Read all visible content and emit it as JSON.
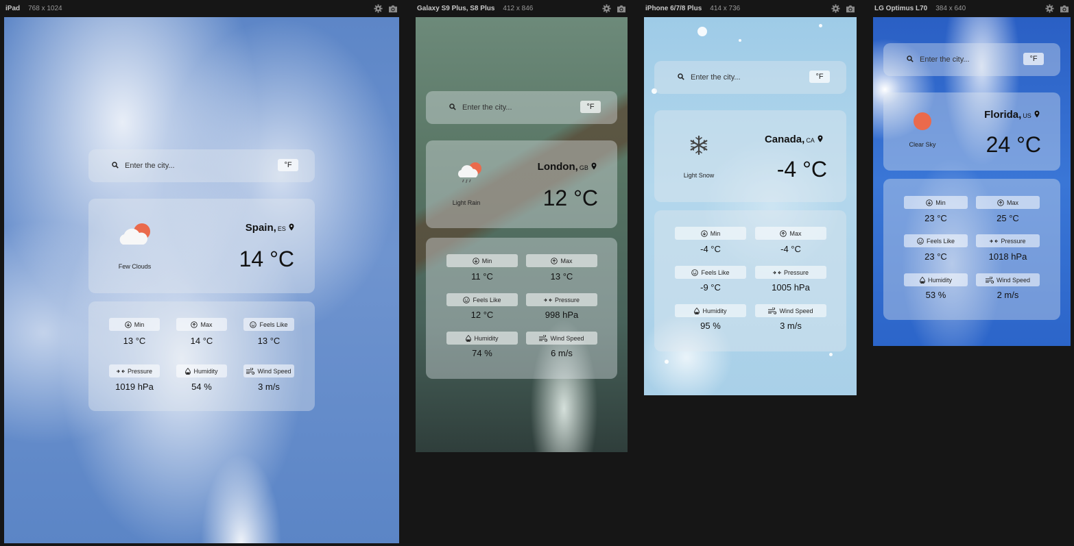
{
  "devices": [
    {
      "name": "iPad",
      "size": "768 x 1024",
      "city": "Spain,",
      "country": "ES",
      "temp": "14 °C",
      "condition": "Few Clouds",
      "icon": "few-clouds-icon",
      "stats": {
        "min": "13 °C",
        "max": "14 °C",
        "feels": "13 °C",
        "pressure": "1019 hPa",
        "humidity": "54 %",
        "wind": "3 m/s"
      }
    },
    {
      "name": "Galaxy S9 Plus, S8 Plus",
      "size": "412 x 846",
      "city": "London,",
      "country": "GB",
      "temp": "12 °C",
      "condition": "Light Rain",
      "icon": "light-rain-icon",
      "stats": {
        "min": "11 °C",
        "max": "13 °C",
        "feels": "12 °C",
        "pressure": "998 hPa",
        "humidity": "74 %",
        "wind": "6 m/s"
      }
    },
    {
      "name": "iPhone 6/7/8 Plus",
      "size": "414 x 736",
      "city": "Canada,",
      "country": "CA",
      "temp": "-4 °C",
      "condition": "Light Snow",
      "icon": "snowflake-icon",
      "stats": {
        "min": "-4 °C",
        "max": "-4 °C",
        "feels": "-9 °C",
        "pressure": "1005 hPa",
        "humidity": "95 %",
        "wind": "3 m/s"
      }
    },
    {
      "name": "LG Optimus L70",
      "size": "384 x 640",
      "city": "Florida,",
      "country": "US",
      "temp": "24 °C",
      "condition": "Clear Sky",
      "icon": "sun-icon",
      "stats": {
        "min": "23 °C",
        "max": "25 °C",
        "feels": "23 °C",
        "pressure": "1018 hPa",
        "humidity": "53 %",
        "wind": "2 m/s"
      }
    }
  ],
  "labels": {
    "search_placeholder": "Enter the city...",
    "unit_toggle": "°F",
    "min": "Min",
    "max": "Max",
    "feels": "Feels Like",
    "pressure": "Pressure",
    "humidity": "Humidity",
    "wind": "Wind Speed"
  },
  "colors": {
    "sun": "#ea6a4c",
    "page_bg": "#161616"
  }
}
